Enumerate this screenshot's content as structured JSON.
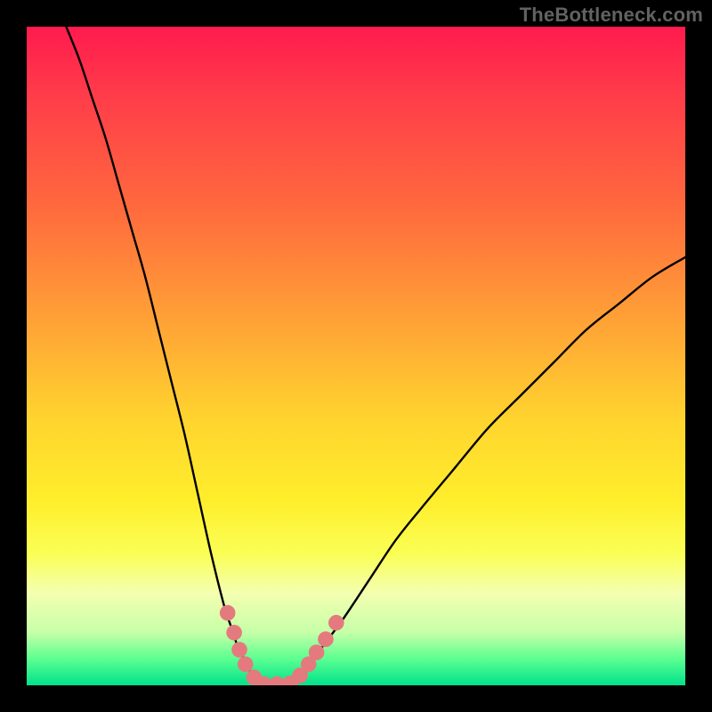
{
  "watermark": "TheBottleneck.com",
  "colors": {
    "frame": "#000000",
    "curve": "#000000",
    "marker_fill": "#e47a7e",
    "marker_stroke": "#e47a7e"
  },
  "chart_data": {
    "type": "line",
    "title": "",
    "xlabel": "",
    "ylabel": "",
    "xlim": [
      0,
      100
    ],
    "ylim": [
      0,
      100
    ],
    "grid": false,
    "series": [
      {
        "name": "bottleneck-curve",
        "x": [
          6,
          8,
          10,
          12,
          14,
          16,
          18,
          20,
          22,
          24,
          26,
          28,
          30,
          31,
          32,
          33,
          34,
          35,
          36,
          37,
          38,
          39,
          40,
          41,
          42,
          43,
          45,
          48,
          52,
          56,
          60,
          65,
          70,
          75,
          80,
          85,
          90,
          95,
          100
        ],
        "y": [
          100,
          95,
          89,
          83,
          76,
          69,
          62,
          54,
          46,
          38,
          29,
          20,
          12,
          9,
          6,
          4,
          2,
          1,
          0,
          0,
          0,
          0,
          0,
          1,
          2,
          3,
          6,
          10,
          16,
          22,
          27,
          33,
          39,
          44,
          49,
          54,
          58,
          62,
          65
        ]
      }
    ],
    "markers": [
      {
        "x": 30.5,
        "y": 11
      },
      {
        "x": 31.5,
        "y": 8
      },
      {
        "x": 32.3,
        "y": 5.4
      },
      {
        "x": 33.2,
        "y": 3.2
      },
      {
        "x": 34.5,
        "y": 1.2
      },
      {
        "x": 36.0,
        "y": 0.2
      },
      {
        "x": 38.0,
        "y": 0.2
      },
      {
        "x": 40.0,
        "y": 0.3
      },
      {
        "x": 41.5,
        "y": 1.5
      },
      {
        "x": 42.8,
        "y": 3.2
      },
      {
        "x": 44.0,
        "y": 5.0
      },
      {
        "x": 45.4,
        "y": 7.0
      },
      {
        "x": 47.0,
        "y": 9.5
      }
    ],
    "annotations": []
  }
}
